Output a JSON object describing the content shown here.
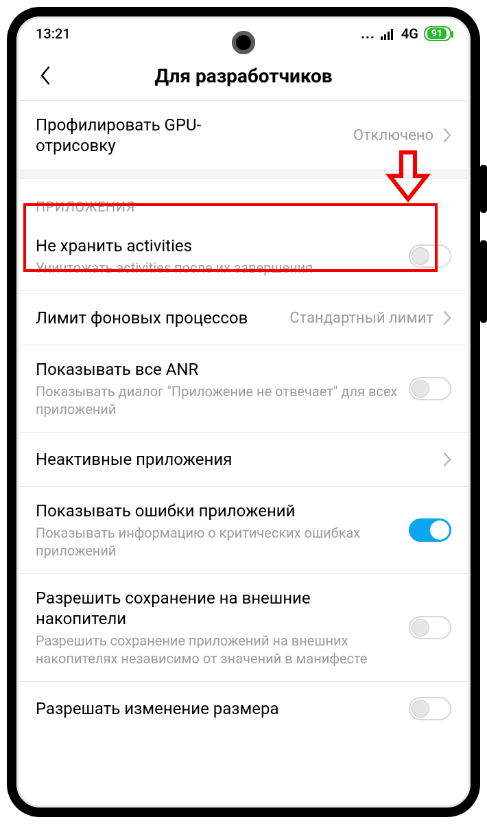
{
  "statusbar": {
    "time": "13:21",
    "network": "4G",
    "battery": "91"
  },
  "header": {
    "title": "Для разработчиков"
  },
  "rows": {
    "gpu": {
      "title": "Профилировать GPU-\nотрисовку",
      "value": "Отключено"
    },
    "section_apps": "ПРИЛОЖЕНИЯ",
    "activities": {
      "title": "Не хранить activities",
      "sub": "Уничтожать activities после их завершения"
    },
    "bg_limit": {
      "title": "Лимит фоновых процессов",
      "value": "Стандартный лимит"
    },
    "anr": {
      "title": "Показывать все ANR",
      "sub": "Показывать диалог \"Приложение не отвечает\" для всех приложений"
    },
    "inactive": {
      "title": "Неактивные приложения"
    },
    "errors": {
      "title": "Показывать ошибки приложений",
      "sub": "Показывать информацию о критических ошибках приложений"
    },
    "external": {
      "title": "Разрешить сохранение на внешние накопители",
      "sub": "Разрешить сохранение приложений на внешних накопителях независимо от значений в манифесте"
    },
    "resize": {
      "title": "Разрешать изменение размера"
    }
  }
}
